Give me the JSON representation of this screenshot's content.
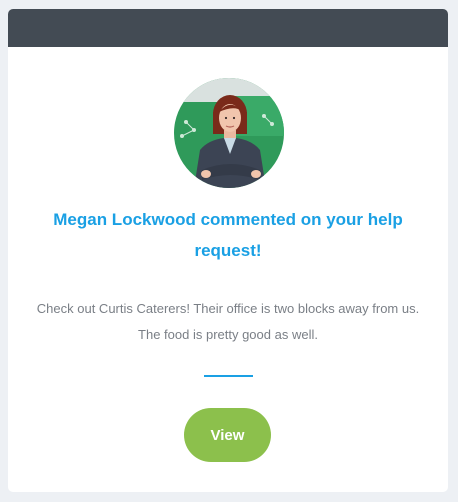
{
  "colors": {
    "header": "#434b54",
    "accent": "#1aa0e4",
    "button": "#8cc04c",
    "body_text": "#7a7f86",
    "page_background": "#edf0f4"
  },
  "avatar": {
    "icon": "user-photo"
  },
  "notification": {
    "headline": "Megan Lockwood commented on your help request!",
    "message_line1": "Check out Curtis Caterers! Their office is two blocks away from us.",
    "message_line2": "The food is pretty good as well."
  },
  "actions": {
    "view_label": "View"
  }
}
